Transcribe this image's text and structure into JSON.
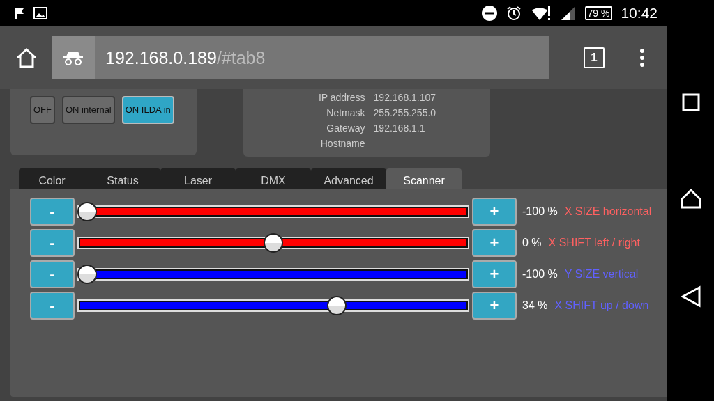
{
  "status_bar": {
    "battery": "79 %",
    "time": "10:42"
  },
  "browser": {
    "url_host": "192.168.0.189",
    "url_path": "/#tab8",
    "tab_count": "1"
  },
  "mode_buttons": [
    {
      "label": "OFF",
      "selected": false
    },
    {
      "label": "ON internal",
      "selected": false
    },
    {
      "label": "ON ILDA in",
      "selected": true
    }
  ],
  "network": [
    {
      "label": "IP address",
      "value": "192.168.1.107",
      "kind": "link"
    },
    {
      "label": "Netmask",
      "value": "255.255.255.0",
      "kind": "plain"
    },
    {
      "label": "Gateway",
      "value": "192.168.1.1",
      "kind": "plain"
    },
    {
      "label": "Hostname",
      "kind": "link"
    }
  ],
  "tabs": [
    {
      "label": "Color",
      "selected": false
    },
    {
      "label": "Status",
      "selected": false
    },
    {
      "label": "Laser",
      "selected": false
    },
    {
      "label": "DMX",
      "selected": false
    },
    {
      "label": "Advanced",
      "selected": false
    },
    {
      "label": "Scanner",
      "selected": true
    }
  ],
  "sliders": [
    {
      "minus": "-",
      "plus": "+",
      "level": 0,
      "reading": "-100 %",
      "name": "X SIZE horizontal",
      "color": "#ff0000"
    },
    {
      "minus": "-",
      "plus": "+",
      "level": 0.5,
      "reading": "0 %",
      "name": "X SHIFT left / right",
      "color": "#ff0000"
    },
    {
      "minus": "-",
      "plus": "+",
      "level": 0,
      "reading": "-100 %",
      "name": "Y SIZE vertical",
      "color": "#0000ff"
    },
    {
      "minus": "-",
      "plus": "+",
      "level": 0.67,
      "reading": "34 %",
      "name": "X SHIFT up / down",
      "color": "#0000ff"
    }
  ]
}
